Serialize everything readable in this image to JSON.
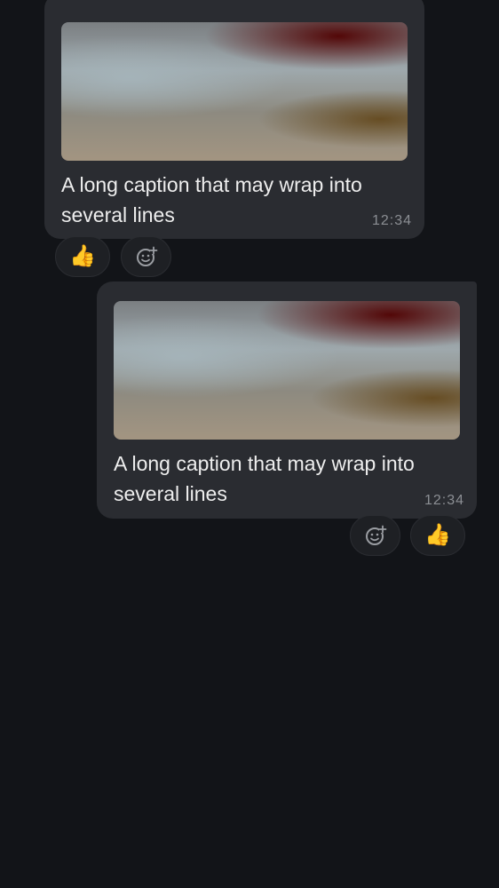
{
  "messages": [
    {
      "direction": "incoming",
      "caption": "A long caption that may wrap into several lines",
      "time": "12:34",
      "reactions": [
        {
          "emoji": "👍"
        }
      ],
      "add_reaction_icon": "add-reaction-icon"
    },
    {
      "direction": "outgoing",
      "caption": "A long caption that may wrap into several lines",
      "time": "12:34",
      "reactions": [
        {
          "emoji": "👍"
        }
      ],
      "add_reaction_icon": "add-reaction-icon"
    }
  ],
  "colors": {
    "background": "#121418",
    "bubble": "#2a2c31",
    "caption_text": "#eeeeee",
    "timestamp": "#8b8e93",
    "reaction_chip": "#1e2024"
  }
}
